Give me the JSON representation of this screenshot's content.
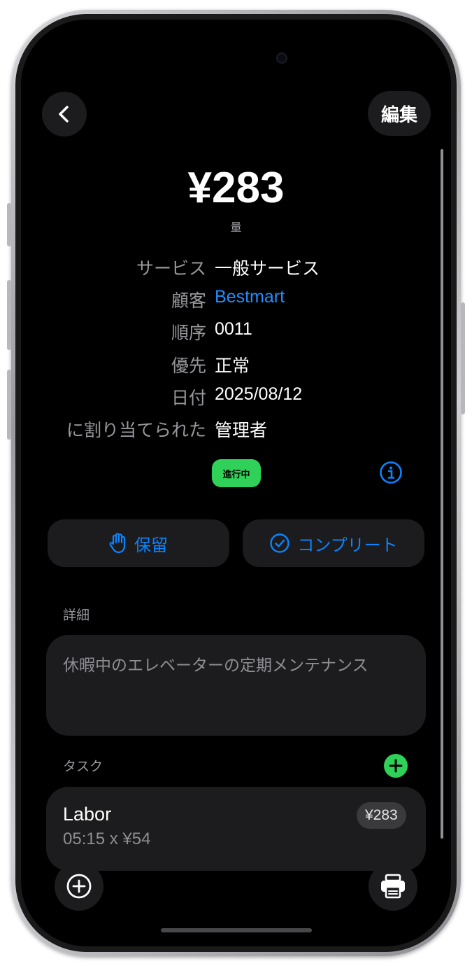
{
  "header": {
    "edit_label": "編集"
  },
  "summary": {
    "amount": "¥283",
    "amount_caption": "量"
  },
  "details": [
    {
      "label": "サービス",
      "value": "一般サービス",
      "is_link": false
    },
    {
      "label": "顧客",
      "value": "Bestmart",
      "is_link": true
    },
    {
      "label": "順序",
      "value": "0011",
      "is_link": false
    },
    {
      "label": "優先",
      "value": "正常",
      "is_link": false
    },
    {
      "label": "日付",
      "value": "2025/08/12",
      "is_link": false
    },
    {
      "label": "に割り当てられた",
      "value": "管理者",
      "is_link": false
    }
  ],
  "status": {
    "label": "進行中",
    "color": "#30d158"
  },
  "actions": {
    "hold_label": "保留",
    "complete_label": "コンプリート"
  },
  "description": {
    "section_title": "詳細",
    "text": "休暇中のエレベーターの定期メンテナンス"
  },
  "tasks": {
    "section_title": "タスク",
    "items": [
      {
        "title": "Labor",
        "subtitle": "05:15 x ¥54",
        "price": "¥283"
      }
    ]
  },
  "colors": {
    "accent": "#0a84ff",
    "link": "#1e90ff",
    "success": "#30d158"
  },
  "icons": [
    "chevron-left-icon",
    "info-icon",
    "hand-icon",
    "checkmark-circle-icon",
    "plus-circle-icon",
    "printer-icon"
  ]
}
